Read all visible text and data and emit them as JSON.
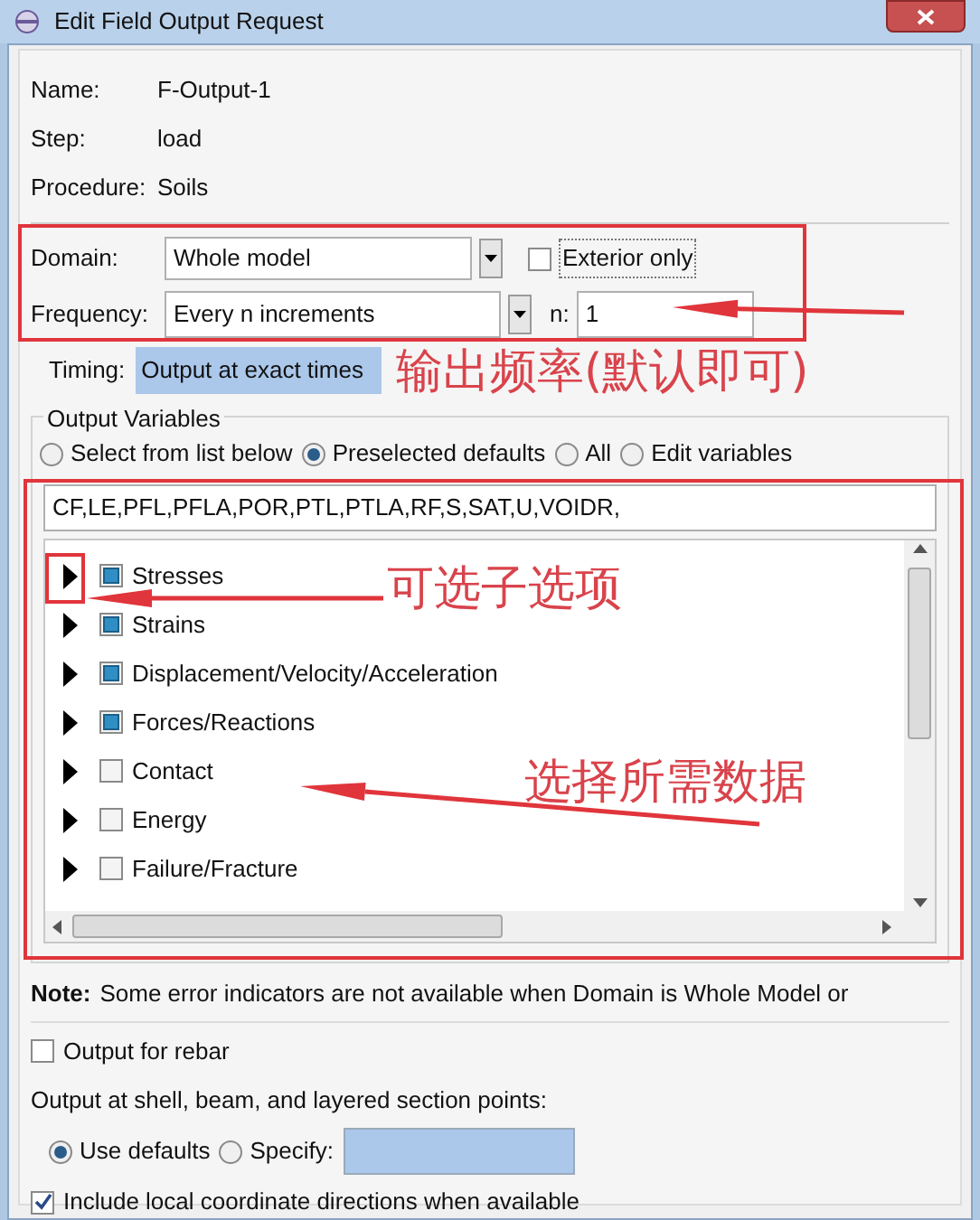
{
  "window": {
    "title": "Edit Field Output Request"
  },
  "info": [
    {
      "label": "Name:",
      "value": "F-Output-1"
    },
    {
      "label": "Step:",
      "value": "load"
    },
    {
      "label": "Procedure:",
      "value": "Soils"
    }
  ],
  "domain": {
    "label": "Domain:",
    "value": "Whole model",
    "exterior_only": {
      "label": "Exterior only",
      "checked": false
    }
  },
  "frequency": {
    "label": "Frequency:",
    "value": "Every n increments",
    "n_label": "n:",
    "n_value": "1"
  },
  "timing": {
    "label": "Timing:",
    "value": "Output at exact times"
  },
  "output_variables": {
    "title": "Output Variables",
    "modes": [
      {
        "label": "Select from list below",
        "selected": false
      },
      {
        "label": "Preselected defaults",
        "selected": true
      },
      {
        "label": "All",
        "selected": false
      },
      {
        "label": "Edit variables",
        "selected": false
      }
    ],
    "variables": "CF,LE,PFL,PFLA,POR,PTL,PTLA,RF,S,SAT,U,VOIDR,",
    "tree": [
      {
        "label": "Stresses",
        "checked": true
      },
      {
        "label": "Strains",
        "checked": true
      },
      {
        "label": "Displacement/Velocity/Acceleration",
        "checked": true
      },
      {
        "label": "Forces/Reactions",
        "checked": true
      },
      {
        "label": "Contact",
        "checked": false
      },
      {
        "label": "Energy",
        "checked": false
      },
      {
        "label": "Failure/Fracture",
        "checked": false
      }
    ]
  },
  "note": {
    "label": "Note:",
    "text": "Some error indicators are not available when Domain is Whole Model or"
  },
  "rebar": {
    "label": "Output for rebar",
    "checked": false
  },
  "section_points": {
    "label": "Output at shell, beam, and layered section points:",
    "options": [
      {
        "label": "Use defaults",
        "selected": true
      },
      {
        "label": "Specify:",
        "selected": false
      }
    ]
  },
  "local_directions": {
    "label": "Include local coordinate directions when available",
    "checked": true
  },
  "annotations": [
    {
      "text": "输出频率(默认即可)"
    },
    {
      "text": "可选子选项"
    },
    {
      "text": "选择所需数据"
    }
  ]
}
